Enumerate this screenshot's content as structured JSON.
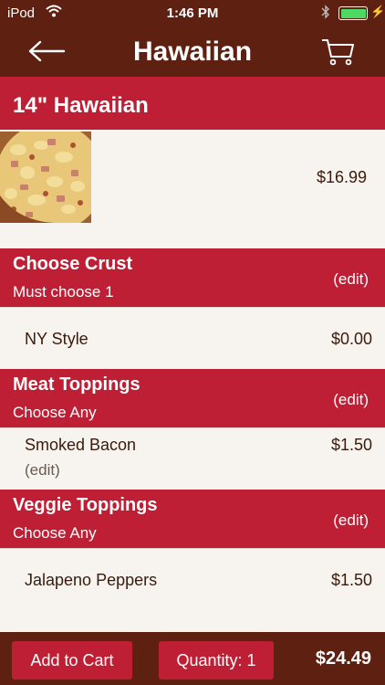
{
  "status_bar": {
    "carrier": "iPod",
    "time": "1:46 PM",
    "battery_level": 1.0
  },
  "navbar": {
    "title": "Hawaiian",
    "back_icon": "back-arrow-icon",
    "cart_icon": "cart-icon"
  },
  "item": {
    "name": "14\" Hawaiian",
    "price": "$16.99",
    "image": "pizza-photo"
  },
  "sections": [
    {
      "title": "Choose Crust",
      "subtitle": "Must choose 1",
      "edit_label": "(edit)",
      "options": [
        {
          "name": "NY Style",
          "price": "$0.00"
        }
      ]
    },
    {
      "title": "Meat Toppings",
      "subtitle": "Choose Any",
      "edit_label": "(edit)",
      "options": [
        {
          "name": "Smoked Bacon",
          "price": "$1.50",
          "edit_label": "(edit)"
        }
      ]
    },
    {
      "title": "Veggie Toppings",
      "subtitle": "Choose Any",
      "edit_label": "(edit)",
      "options": [
        {
          "name": "Jalapeno Peppers",
          "price": "$1.50"
        }
      ]
    }
  ],
  "bottom_bar": {
    "add_to_cart_label": "Add to Cart",
    "quantity_label": "Quantity: 1",
    "total": "$24.49"
  },
  "colors": {
    "brown": "#5e2010",
    "red": "#be1f34",
    "background": "#f7f4ef",
    "text": "#3a1a0c"
  }
}
